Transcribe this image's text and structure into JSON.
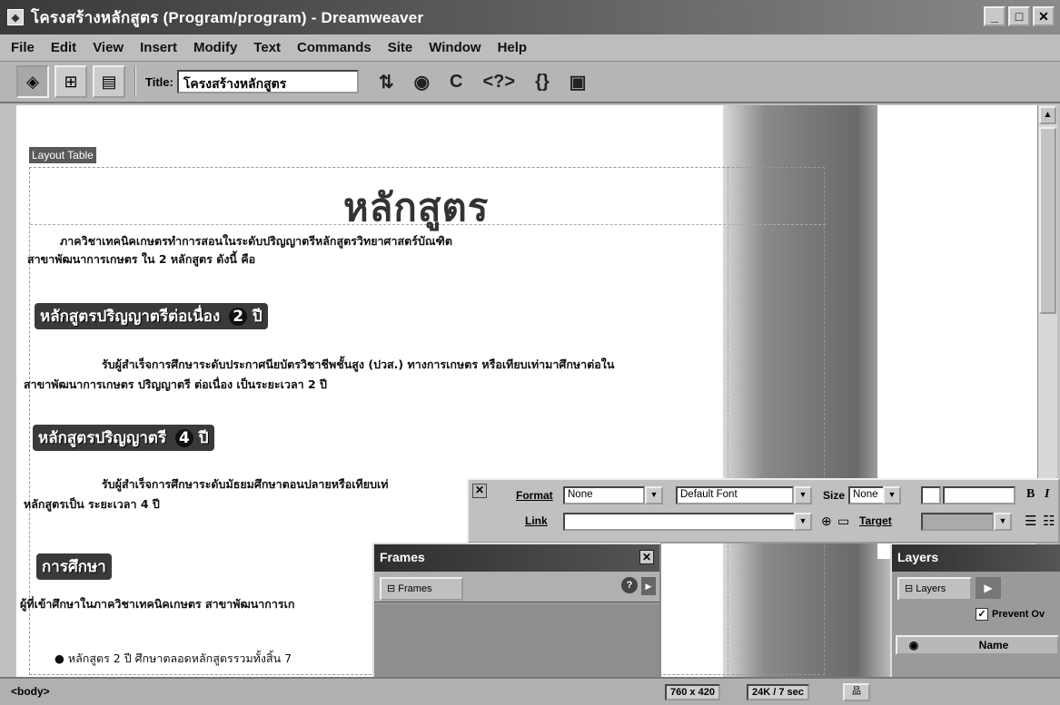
{
  "window": {
    "title": "โครงสร้างหลักสูตร (Program/program) - Dreamweaver",
    "app_icon": "dreamweaver-icon",
    "controls": [
      "minimize",
      "maximize",
      "close"
    ]
  },
  "menubar": {
    "items": [
      "File",
      "Edit",
      "View",
      "Insert",
      "Modify",
      "Text",
      "Commands",
      "Site",
      "Window",
      "Help"
    ]
  },
  "toolbar": {
    "title_label": "Title:",
    "title_value": "โครงสร้างหลักสูตร"
  },
  "document": {
    "layout_tag": "Layout Table",
    "heading": "หลักสูตร",
    "intro_line1": "ภาควิชาเทคนิคเกษตรทำการสอนในระดับปริญญาตรีหลักสูตรวิทยาศาสตร์บัณฑิต",
    "intro_line2": "สาขาพัฒนาการเกษตร ใน 2 หลักสูตร ดังนี้ คือ",
    "section1_title": "หลักสูตรปริญญาตรีต่อเนื่อง",
    "section1_num": "2",
    "section1_unit": "ปี",
    "section1_line1": "รับผู้สำเร็จการศึกษาระดับประกาศนียบัตรวิชาชีพชั้นสูง (ปวส.) ทางการเกษตร หรือเทียบเท่ามาศึกษาต่อใน",
    "section1_line2": "สาขาพัฒนาการเกษตร ปริญญาตรี ต่อเนื่อง เป็นระยะเวลา 2 ปี",
    "section2_title": "หลักสูตรปริญญาตรี",
    "section2_num": "4",
    "section2_unit": "ปี",
    "section2_line1": "รับผู้สำเร็จการศึกษาระดับมัธยมศึกษาตอนปลายหรือเทียบเท่",
    "section2_line2": "หลักสูตรเป็น ระยะเวลา 4 ปี",
    "section3_title": "การศึกษา",
    "section3_line1": "ผู้ที่เข้าศึกษาในภาควิชาเทคนิคเกษตร สาขาพัฒนาการเก",
    "bullet1": "● หลักสูตร 2 ปี ศึกษาตลอดหลักสูตรรวมทั้งสิ้น   7"
  },
  "properties": {
    "format_label": "Format",
    "format_value": "None",
    "font_value": "Default Font",
    "size_label": "Size",
    "size_value": "None",
    "link_label": "Link",
    "target_label": "Target",
    "bold": "B",
    "italic": "I"
  },
  "frames_panel": {
    "title": "Frames",
    "tab_label": "Frames"
  },
  "layers_panel": {
    "title": "Layers",
    "tab_label": "Layers",
    "prevent_overlaps": "Prevent Ov",
    "name_header": "Name"
  },
  "statusbar": {
    "tag": "<body>",
    "window_size": "760 x 420",
    "download": "24K / 7 sec"
  }
}
